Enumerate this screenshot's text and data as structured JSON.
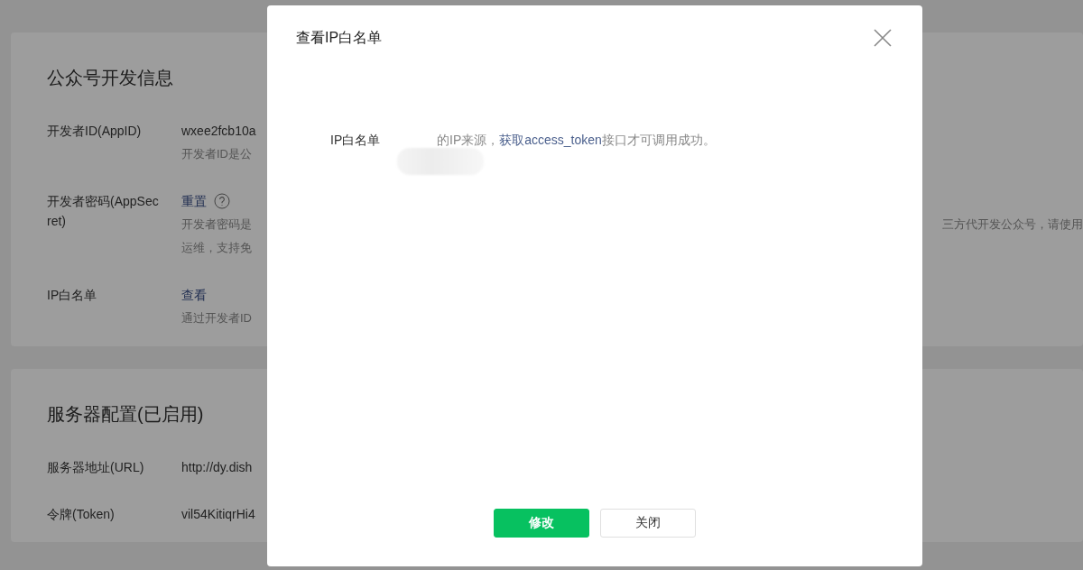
{
  "sections": [
    {
      "title": "公众号开发信息",
      "rows": [
        {
          "label": "开发者ID(AppID)",
          "kind": "text",
          "value": "wxee2fcb10a",
          "notes": [
            {
              "left": "开发者ID是公"
            }
          ]
        },
        {
          "label": "开发者密码(AppSecret)",
          "kind": "link",
          "value": "重置",
          "help": true,
          "notes": [
            {
              "left": "开发者密码是",
              "right": "三方代开发公众号，请使用"
            },
            {
              "left": "运维，支持免"
            }
          ]
        },
        {
          "label": "IP白名单",
          "kind": "link",
          "value": "查看",
          "notes": [
            {
              "left": "通过开发者ID"
            }
          ]
        }
      ]
    },
    {
      "title": "服务器配置(已启用)",
      "rows": [
        {
          "label": "服务器地址(URL)",
          "kind": "text",
          "value": "http://dy.dish"
        },
        {
          "label": "令牌(Token)",
          "kind": "text",
          "value": "vil54KitiqrHi4"
        }
      ]
    }
  ],
  "modal": {
    "title": "查看IP白名单",
    "field": {
      "label": "IP白名单",
      "text_before": "的IP来源，",
      "link": "获取access_token",
      "text_after": "接口才可调用成功。"
    },
    "buttons": [
      {
        "label": "修改",
        "kind": "primary"
      },
      {
        "label": "关闭",
        "kind": "default"
      }
    ]
  }
}
